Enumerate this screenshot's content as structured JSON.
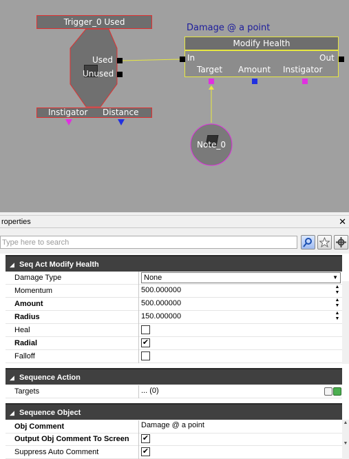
{
  "canvas": {
    "trigger_node": {
      "title": "Trigger_0 Used",
      "outputs": [
        "Used",
        "Unused"
      ],
      "vars": [
        "Instigator",
        "Distance"
      ]
    },
    "action_node": {
      "comment": "Damage @ a point",
      "title": "Modify Health",
      "input": "In",
      "output": "Out",
      "vars": [
        "Target",
        "Amount",
        "Instigator"
      ]
    },
    "note_node": {
      "label": "Note_0"
    },
    "colors": {
      "canvas_bg": "#a0a0a0",
      "wire": "#e8e840",
      "magenta_link": "#e030e0",
      "blue_link": "#2030e0",
      "selected_border": "#e8e840",
      "unselected_border": "#e03030"
    }
  },
  "properties_panel": {
    "title": "roperties",
    "close_icon": "close-icon",
    "search": {
      "placeholder": "Type here to search",
      "value": ""
    },
    "buttons": [
      "search-icon",
      "favorite-icon",
      "options-icon"
    ],
    "categories": [
      {
        "label": "Seq Act Modify Health",
        "rows": [
          {
            "name": "Damage Type",
            "type": "dropdown",
            "value": "None",
            "bold": false
          },
          {
            "name": "Momentum",
            "type": "number",
            "value": "500.000000",
            "bold": false
          },
          {
            "name": "Amount",
            "type": "number",
            "value": "500.000000",
            "bold": true
          },
          {
            "name": "Radius",
            "type": "number",
            "value": "150.000000",
            "bold": true
          },
          {
            "name": "Heal",
            "type": "checkbox",
            "checked": false,
            "bold": false
          },
          {
            "name": "Radial",
            "type": "checkbox",
            "checked": true,
            "bold": true
          },
          {
            "name": "Falloff",
            "type": "checkbox",
            "checked": false,
            "bold": false
          }
        ]
      },
      {
        "label": "Sequence Action",
        "rows": [
          {
            "name": "Targets",
            "type": "array",
            "value": "... (0)",
            "bold": false
          }
        ]
      },
      {
        "label": "Sequence Object",
        "rows": [
          {
            "name": "Obj Comment",
            "type": "text",
            "value": "Damage @ a point",
            "bold": true
          },
          {
            "name": "Output Obj Comment To Screen",
            "type": "checkbox",
            "checked": true,
            "bold": true
          },
          {
            "name": "Suppress Auto Comment",
            "type": "checkbox",
            "checked": true,
            "bold": false
          }
        ]
      }
    ]
  }
}
